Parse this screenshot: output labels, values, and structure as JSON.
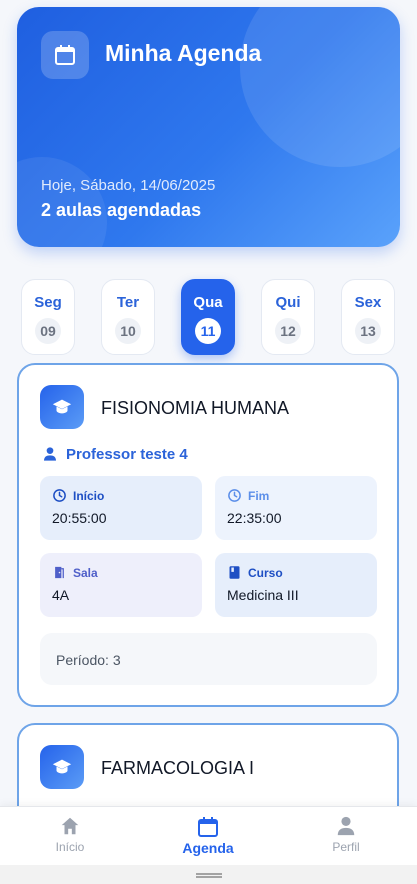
{
  "header": {
    "title": "Minha Agenda",
    "date_text": "Hoje, Sábado, 14/06/2025",
    "count_text": "2 aulas agendadas",
    "icon": "calendar-icon"
  },
  "days": [
    {
      "name": "Seg",
      "number": "09",
      "active": false
    },
    {
      "name": "Ter",
      "number": "10",
      "active": false
    },
    {
      "name": "Qua",
      "number": "11",
      "active": true
    },
    {
      "name": "Qui",
      "number": "12",
      "active": false
    },
    {
      "name": "Sex",
      "number": "13",
      "active": false
    }
  ],
  "classes": [
    {
      "title": "FISIONOMIA HUMANA",
      "teacher": "Professor teste 4",
      "start_label": "Início",
      "start_value": "20:55:00",
      "end_label": "Fim",
      "end_value": "22:35:00",
      "room_label": "Sala",
      "room_value": "4A",
      "course_label": "Curso",
      "course_value": "Medicina III",
      "period_text": "Período: 3"
    },
    {
      "title": "FARMACOLOGIA I"
    }
  ],
  "nav": {
    "inicio": "Início",
    "agenda": "Agenda",
    "perfil": "Perfil"
  },
  "colors": {
    "accent": "#2563eb",
    "card_border": "#6ea4e8"
  }
}
